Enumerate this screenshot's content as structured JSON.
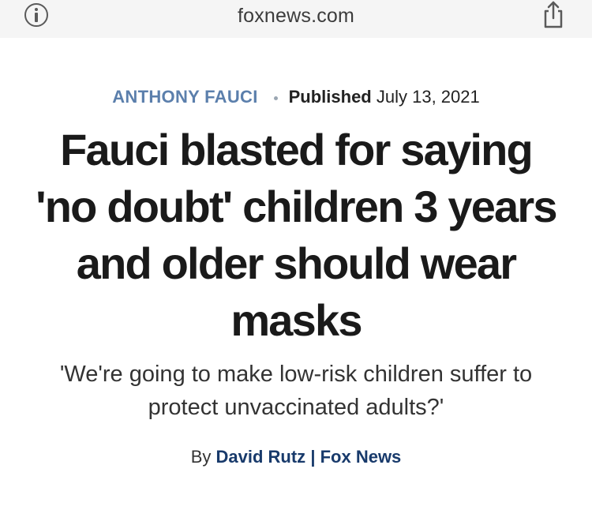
{
  "browser": {
    "url": "foxnews.com",
    "info_icon": "info-circle-icon",
    "share_icon": "share-icon"
  },
  "article": {
    "kicker": "ANTHONY FAUCI",
    "published_label": "Published",
    "published_date": "July 13, 2021",
    "headline": "Fauci blasted for saying 'no doubt' children 3 years and older should wear masks",
    "subheadline": "'We're going to make low-risk children suffer to protect unvaccinated adults?'",
    "byline": {
      "prefix": "By",
      "author": "David Rutz",
      "separator": "|",
      "outlet": "Fox News"
    }
  },
  "colors": {
    "kicker": "#5b7fac",
    "byline_link": "#183a6b",
    "topbar_bg": "#f5f5f5"
  }
}
